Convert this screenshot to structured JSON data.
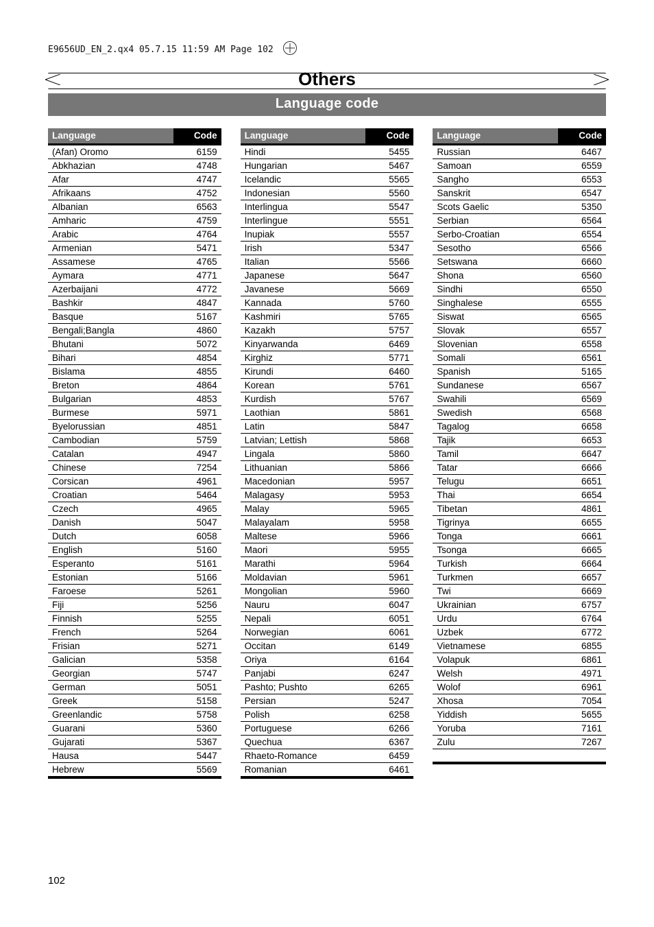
{
  "header_line": "E9656UD_EN_2.qx4   05.7.15   11:59 AM   Page 102",
  "title": "Others",
  "subtitle": "Language code",
  "col_header_lang": "Language",
  "col_header_code": "Code",
  "columns": [
    [
      {
        "lang": "(Afan) Oromo",
        "code": "6159"
      },
      {
        "lang": "Abkhazian",
        "code": "4748"
      },
      {
        "lang": "Afar",
        "code": "4747"
      },
      {
        "lang": "Afrikaans",
        "code": "4752"
      },
      {
        "lang": "Albanian",
        "code": "6563"
      },
      {
        "lang": "Amharic",
        "code": "4759"
      },
      {
        "lang": "Arabic",
        "code": "4764"
      },
      {
        "lang": "Armenian",
        "code": "5471"
      },
      {
        "lang": "Assamese",
        "code": "4765"
      },
      {
        "lang": "Aymara",
        "code": "4771"
      },
      {
        "lang": "Azerbaijani",
        "code": "4772"
      },
      {
        "lang": "Bashkir",
        "code": "4847"
      },
      {
        "lang": "Basque",
        "code": "5167"
      },
      {
        "lang": "Bengali;Bangla",
        "code": "4860"
      },
      {
        "lang": "Bhutani",
        "code": "5072"
      },
      {
        "lang": "Bihari",
        "code": "4854"
      },
      {
        "lang": "Bislama",
        "code": "4855"
      },
      {
        "lang": "Breton",
        "code": "4864"
      },
      {
        "lang": "Bulgarian",
        "code": "4853"
      },
      {
        "lang": "Burmese",
        "code": "5971"
      },
      {
        "lang": "Byelorussian",
        "code": "4851"
      },
      {
        "lang": "Cambodian",
        "code": "5759"
      },
      {
        "lang": "Catalan",
        "code": "4947"
      },
      {
        "lang": "Chinese",
        "code": "7254"
      },
      {
        "lang": "Corsican",
        "code": "4961"
      },
      {
        "lang": "Croatian",
        "code": "5464"
      },
      {
        "lang": "Czech",
        "code": "4965"
      },
      {
        "lang": "Danish",
        "code": "5047"
      },
      {
        "lang": "Dutch",
        "code": "6058"
      },
      {
        "lang": "English",
        "code": "5160"
      },
      {
        "lang": "Esperanto",
        "code": "5161"
      },
      {
        "lang": "Estonian",
        "code": "5166"
      },
      {
        "lang": "Faroese",
        "code": "5261"
      },
      {
        "lang": "Fiji",
        "code": "5256"
      },
      {
        "lang": "Finnish",
        "code": "5255"
      },
      {
        "lang": "French",
        "code": "5264"
      },
      {
        "lang": "Frisian",
        "code": "5271"
      },
      {
        "lang": "Galician",
        "code": "5358"
      },
      {
        "lang": "Georgian",
        "code": "5747"
      },
      {
        "lang": "German",
        "code": "5051"
      },
      {
        "lang": "Greek",
        "code": "5158"
      },
      {
        "lang": "Greenlandic",
        "code": "5758"
      },
      {
        "lang": "Guarani",
        "code": "5360"
      },
      {
        "lang": "Gujarati",
        "code": "5367"
      },
      {
        "lang": "Hausa",
        "code": "5447"
      },
      {
        "lang": "Hebrew",
        "code": "5569"
      }
    ],
    [
      {
        "lang": "Hindi",
        "code": "5455"
      },
      {
        "lang": "Hungarian",
        "code": "5467"
      },
      {
        "lang": "Icelandic",
        "code": "5565"
      },
      {
        "lang": "Indonesian",
        "code": "5560"
      },
      {
        "lang": "Interlingua",
        "code": "5547"
      },
      {
        "lang": "Interlingue",
        "code": "5551"
      },
      {
        "lang": "Inupiak",
        "code": "5557"
      },
      {
        "lang": "Irish",
        "code": "5347"
      },
      {
        "lang": "Italian",
        "code": "5566"
      },
      {
        "lang": "Japanese",
        "code": "5647"
      },
      {
        "lang": "Javanese",
        "code": "5669"
      },
      {
        "lang": "Kannada",
        "code": "5760"
      },
      {
        "lang": "Kashmiri",
        "code": "5765"
      },
      {
        "lang": "Kazakh",
        "code": "5757"
      },
      {
        "lang": "Kinyarwanda",
        "code": "6469"
      },
      {
        "lang": "Kirghiz",
        "code": "5771"
      },
      {
        "lang": "Kirundi",
        "code": "6460"
      },
      {
        "lang": "Korean",
        "code": "5761"
      },
      {
        "lang": "Kurdish",
        "code": "5767"
      },
      {
        "lang": "Laothian",
        "code": "5861"
      },
      {
        "lang": "Latin",
        "code": "5847"
      },
      {
        "lang": "Latvian; Lettish",
        "code": "5868"
      },
      {
        "lang": "Lingala",
        "code": "5860"
      },
      {
        "lang": "Lithuanian",
        "code": "5866"
      },
      {
        "lang": "Macedonian",
        "code": "5957"
      },
      {
        "lang": "Malagasy",
        "code": "5953"
      },
      {
        "lang": "Malay",
        "code": "5965"
      },
      {
        "lang": "Malayalam",
        "code": "5958"
      },
      {
        "lang": "Maltese",
        "code": "5966"
      },
      {
        "lang": "Maori",
        "code": "5955"
      },
      {
        "lang": "Marathi",
        "code": "5964"
      },
      {
        "lang": "Moldavian",
        "code": "5961"
      },
      {
        "lang": "Mongolian",
        "code": "5960"
      },
      {
        "lang": "Nauru",
        "code": "6047"
      },
      {
        "lang": "Nepali",
        "code": "6051"
      },
      {
        "lang": "Norwegian",
        "code": "6061"
      },
      {
        "lang": "Occitan",
        "code": "6149"
      },
      {
        "lang": "Oriya",
        "code": "6164"
      },
      {
        "lang": "Panjabi",
        "code": "6247"
      },
      {
        "lang": "Pashto; Pushto",
        "code": "6265"
      },
      {
        "lang": "Persian",
        "code": "5247"
      },
      {
        "lang": "Polish",
        "code": "6258"
      },
      {
        "lang": "Portuguese",
        "code": "6266"
      },
      {
        "lang": "Quechua",
        "code": "6367"
      },
      {
        "lang": "Rhaeto-Romance",
        "code": "6459"
      },
      {
        "lang": "Romanian",
        "code": "6461"
      }
    ],
    [
      {
        "lang": "Russian",
        "code": "6467"
      },
      {
        "lang": "Samoan",
        "code": "6559"
      },
      {
        "lang": "Sangho",
        "code": "6553"
      },
      {
        "lang": "Sanskrit",
        "code": "6547"
      },
      {
        "lang": "Scots Gaelic",
        "code": "5350"
      },
      {
        "lang": "Serbian",
        "code": "6564"
      },
      {
        "lang": "Serbo-Croatian",
        "code": "6554"
      },
      {
        "lang": "Sesotho",
        "code": "6566"
      },
      {
        "lang": "Setswana",
        "code": "6660"
      },
      {
        "lang": "Shona",
        "code": "6560"
      },
      {
        "lang": "Sindhi",
        "code": "6550"
      },
      {
        "lang": "Singhalese",
        "code": "6555"
      },
      {
        "lang": "Siswat",
        "code": "6565"
      },
      {
        "lang": "Slovak",
        "code": "6557"
      },
      {
        "lang": "Slovenian",
        "code": "6558"
      },
      {
        "lang": "Somali",
        "code": "6561"
      },
      {
        "lang": "Spanish",
        "code": "5165"
      },
      {
        "lang": "Sundanese",
        "code": "6567"
      },
      {
        "lang": "Swahili",
        "code": "6569"
      },
      {
        "lang": "Swedish",
        "code": "6568"
      },
      {
        "lang": "Tagalog",
        "code": "6658"
      },
      {
        "lang": "Tajik",
        "code": "6653"
      },
      {
        "lang": "Tamil",
        "code": "6647"
      },
      {
        "lang": "Tatar",
        "code": "6666"
      },
      {
        "lang": "Telugu",
        "code": "6651"
      },
      {
        "lang": "Thai",
        "code": "6654"
      },
      {
        "lang": "Tibetan",
        "code": "4861"
      },
      {
        "lang": "Tigrinya",
        "code": "6655"
      },
      {
        "lang": "Tonga",
        "code": "6661"
      },
      {
        "lang": "Tsonga",
        "code": "6665"
      },
      {
        "lang": "Turkish",
        "code": "6664"
      },
      {
        "lang": "Turkmen",
        "code": "6657"
      },
      {
        "lang": "Twi",
        "code": "6669"
      },
      {
        "lang": "Ukrainian",
        "code": "6757"
      },
      {
        "lang": "Urdu",
        "code": "6764"
      },
      {
        "lang": "Uzbek",
        "code": "6772"
      },
      {
        "lang": "Vietnamese",
        "code": "6855"
      },
      {
        "lang": "Volapuk",
        "code": "6861"
      },
      {
        "lang": "Welsh",
        "code": "4971"
      },
      {
        "lang": "Wolof",
        "code": "6961"
      },
      {
        "lang": "Xhosa",
        "code": "7054"
      },
      {
        "lang": "Yiddish",
        "code": "5655"
      },
      {
        "lang": "Yoruba",
        "code": "7161"
      },
      {
        "lang": "Zulu",
        "code": "7267"
      }
    ]
  ],
  "page_number": "102"
}
